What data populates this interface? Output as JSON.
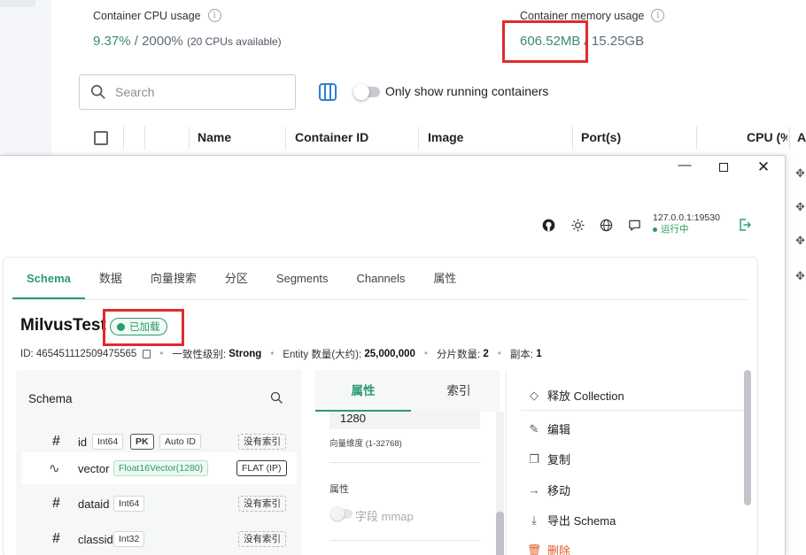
{
  "docker": {
    "cpu_label": "Container CPU usage",
    "cpu_value": "9.37%",
    "cpu_sep": " / ",
    "cpu_total": "2000%",
    "cpu_note": "(20 CPUs available)",
    "mem_label": "Container memory usage",
    "mem_value": "606.52MB",
    "mem_total": " / 15.25GB",
    "search_placeholder": "Search",
    "toggle_label": "Only show running containers",
    "columns": [
      "Name",
      "Container ID",
      "Image",
      "Port(s)",
      "CPU (%",
      "A"
    ]
  },
  "attu": {
    "connection": {
      "address": "127.0.0.1:19530",
      "status": "运行中"
    },
    "tabs": [
      "Schema",
      "数据",
      "向量搜索",
      "分区",
      "Segments",
      "Channels",
      "属性"
    ],
    "collection": {
      "name": "MilvusTest",
      "status": "已加载",
      "id_label": "ID:",
      "id": "465451112509475565",
      "consistency_label": "一致性级别:",
      "consistency": "Strong",
      "entity_label": "Entity 数量(大约):",
      "entity_count": "25,000,000",
      "shards_label": "分片数量:",
      "shards": "2",
      "replicas_label": "副本:",
      "replicas": "1"
    },
    "schema": {
      "title": "Schema",
      "fields": [
        {
          "icon": "#",
          "name": "id",
          "type": "Int64",
          "pk": "PK",
          "auto": "Auto ID",
          "index": "没有索引"
        },
        {
          "icon": "∿",
          "name": "vector",
          "type": "Float16Vector(1280)",
          "index": "FLAT (IP)"
        },
        {
          "icon": "#",
          "name": "dataid",
          "type": "Int64",
          "index": "没有索引"
        },
        {
          "icon": "#",
          "name": "classid",
          "type": "Int32",
          "index": "没有索引"
        }
      ]
    },
    "attributes": {
      "tab_props": "属性",
      "tab_index": "索引",
      "dim_value": "1280",
      "dim_label": "向量维度 (1-32768)",
      "props_label": "属性",
      "mmap_label": "字段 mmap"
    },
    "actions": [
      {
        "icon": "release-icon",
        "label": "释放 Collection"
      },
      {
        "icon": "edit-icon",
        "label": "编辑"
      },
      {
        "icon": "copy-icon",
        "label": "复制"
      },
      {
        "icon": "move-icon",
        "label": "移动"
      },
      {
        "icon": "download-icon",
        "label": "导出 Schema"
      },
      {
        "icon": "trash-icon",
        "label": "删除"
      }
    ]
  },
  "colors": {
    "accent": "#2b9b6e",
    "danger": "#e0592a",
    "highlight": "#e02b2b",
    "link_blue": "#2d7fd4"
  }
}
